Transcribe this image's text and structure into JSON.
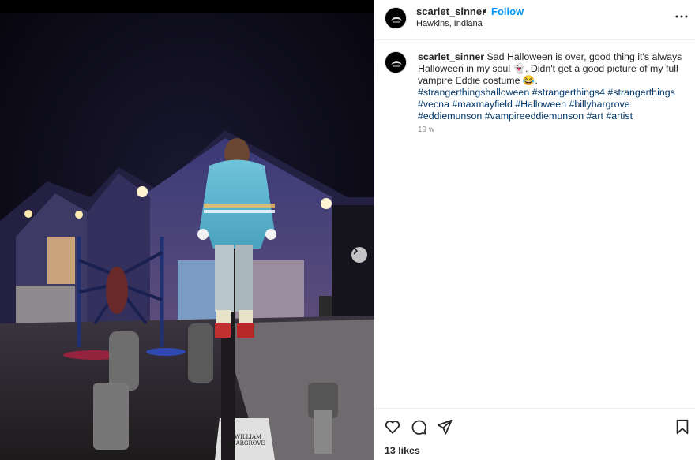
{
  "post": {
    "username": "scarlet_sinner",
    "separator": "•",
    "follow_label": "Follow",
    "location": "Hawkins, Indiana",
    "caption_text": "Sad Halloween is over, good thing it's always Halloween in my soul 👻. Didn't get a good picture of my full vampire Eddie costume 😂.",
    "hashtags": "#strangerthingshalloween #strangerthings4 #strangerthings #vecna #maxmayfield #Halloween #billyhargrove #eddiemunson #vampireeddiemunson #art #artist",
    "timestamp": "19 w",
    "likes": "13 likes",
    "tombstone_text": "WILLIAM HARGROVE"
  },
  "icons": {
    "more": "more-options-icon",
    "next": "chevron-right-icon",
    "like": "heart-icon",
    "comment": "comment-icon",
    "share": "send-icon",
    "save": "bookmark-icon"
  },
  "colors": {
    "follow": "#0095f6",
    "hashtag": "#00376b",
    "muted": "#8e8e8e",
    "text": "#262626"
  }
}
